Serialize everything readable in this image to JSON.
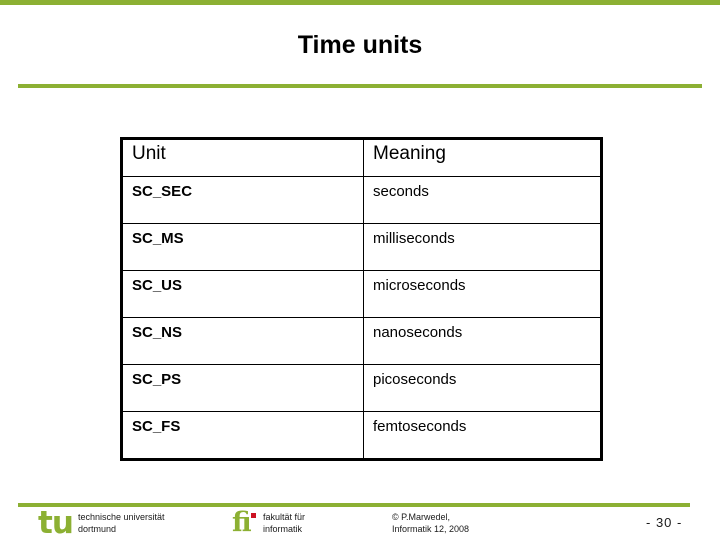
{
  "colors": {
    "accent_green": "#8cb033",
    "logo_red": "#cc1122",
    "text": "#000000"
  },
  "slide": {
    "title": "Time units"
  },
  "table": {
    "columns": [
      {
        "label": "Unit"
      },
      {
        "label": "Meaning"
      }
    ],
    "rows": [
      {
        "unit": "SC_SEC",
        "meaning": "seconds"
      },
      {
        "unit": "SC_MS",
        "meaning": "milliseconds"
      },
      {
        "unit": "SC_US",
        "meaning": "microseconds"
      },
      {
        "unit": "SC_NS",
        "meaning": "nanoseconds"
      },
      {
        "unit": "SC_PS",
        "meaning": "picoseconds"
      },
      {
        "unit": "SC_FS",
        "meaning": "femtoseconds"
      }
    ]
  },
  "footer": {
    "tu_logo_text": "tu",
    "tu_line1": "technische universität",
    "tu_line2": "dortmund",
    "fi_logo_text": "fi",
    "fi_line1": "fakultät für",
    "fi_line2": "informatik",
    "copyright_line1": "© P.Marwedel,",
    "copyright_line2": "Informatik 12,  2008",
    "page_number": "-  30 -"
  }
}
